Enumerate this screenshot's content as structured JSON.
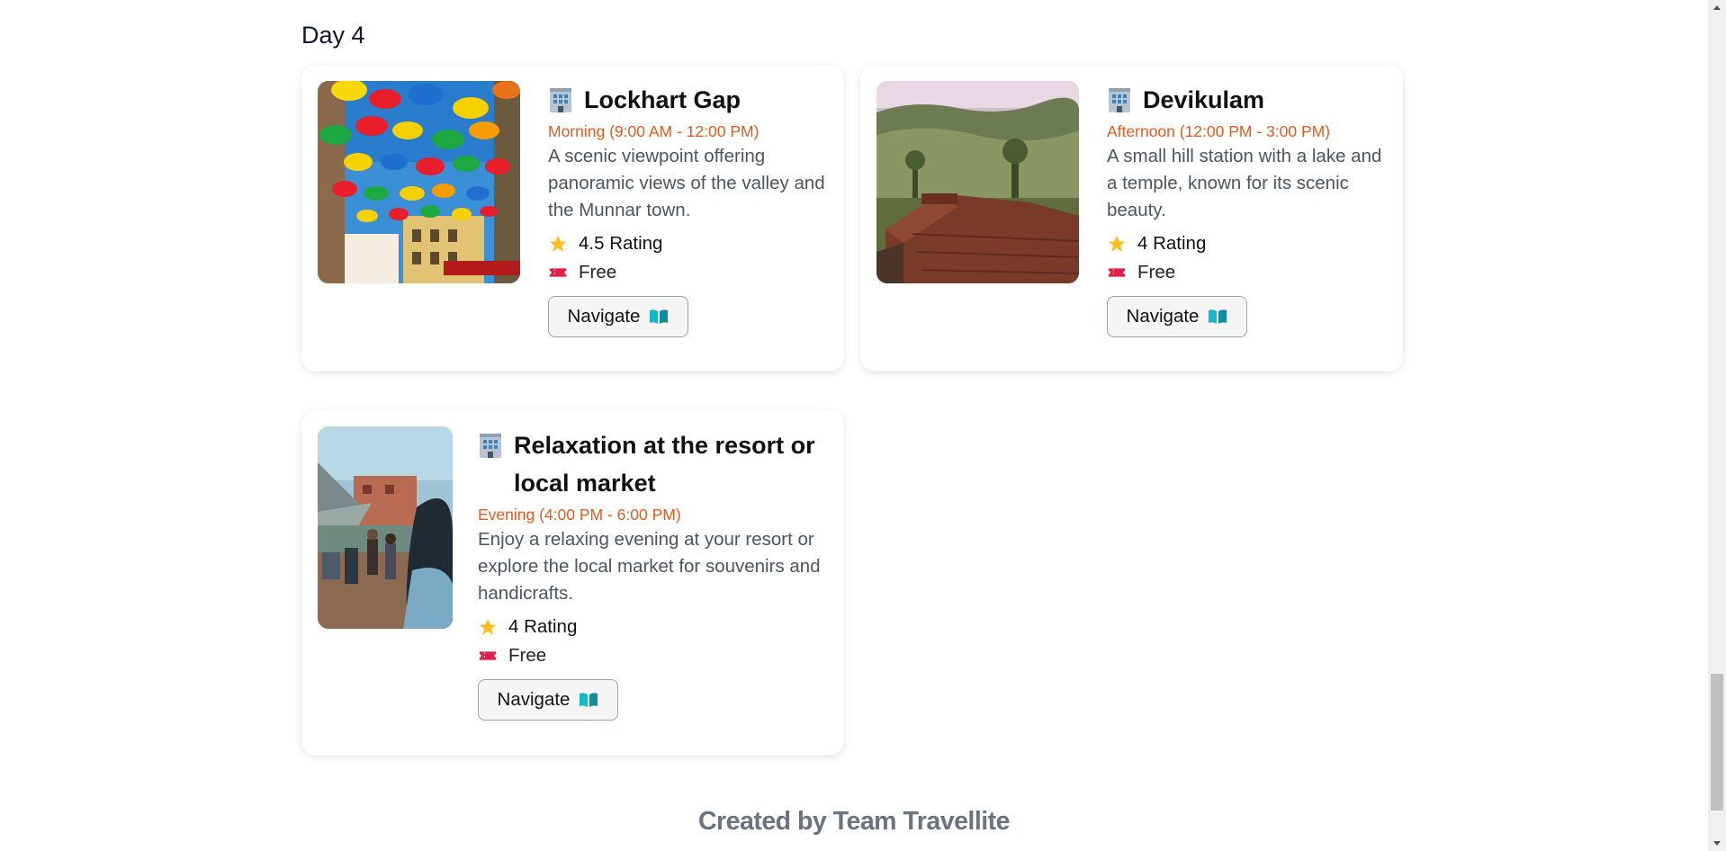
{
  "day": {
    "title": "Day 4"
  },
  "places": [
    {
      "icon": "building-icon",
      "name": "Lockhart Gap",
      "time": "Morning (9:00 AM - 12:00 PM)",
      "description": "A scenic viewpoint offering panoramic views of the valley and the Munnar town.",
      "rating": "4.5 Rating",
      "fee": "Free",
      "navigate_label": "Navigate",
      "image": "colorful-umbrellas-street-photo"
    },
    {
      "icon": "building-icon",
      "name": "Devikulam",
      "time": "Afternoon (12:00 PM - 3:00 PM)",
      "description": "A small hill station with a lake and a temple, known for its scenic beauty.",
      "rating": "4 Rating",
      "fee": "Free",
      "navigate_label": "Navigate",
      "image": "hill-station-rusty-roof-photo"
    },
    {
      "icon": "building-icon",
      "name": "Relaxation at the resort or local market",
      "time": "Evening (4:00 PM - 6:00 PM)",
      "description": "Enjoy a relaxing evening at your resort or explore the local market for souvenirs and handicrafts.",
      "rating": "4 Rating",
      "fee": "Free",
      "navigate_label": "Navigate",
      "image": "outdoor-market-stalls-photo"
    }
  ],
  "footer": {
    "text": "Created by Team Travellite"
  },
  "colors": {
    "time_accent": "#e35a1c",
    "description": "#4b5563",
    "footer": "#6b7280",
    "star": "#fbbf24",
    "ticket": "#e11d48",
    "map_book": "#14b8c8"
  }
}
